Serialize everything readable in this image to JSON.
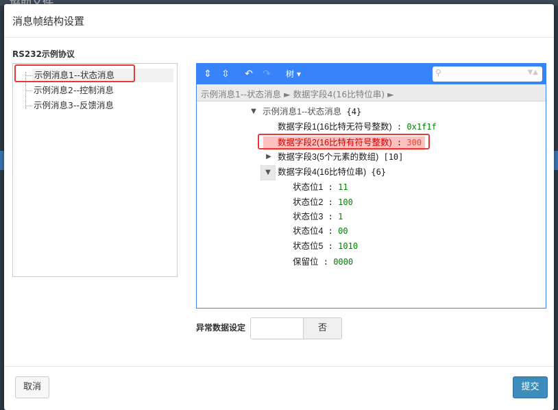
{
  "background": {
    "title": "協助文件"
  },
  "modal": {
    "title": "消息帧结构设置",
    "protocol_title": "RS232示例协议",
    "messages": [
      {
        "label": "示例消息1--状态消息",
        "selected": true
      },
      {
        "label": "示例消息2--控制消息",
        "selected": false
      },
      {
        "label": "示例消息3--反馈消息",
        "selected": false
      }
    ],
    "editor": {
      "menu": {
        "expand_all_icon": "expand-all-icon",
        "collapse_all_icon": "collapse-all-icon",
        "undo_icon": "undo-icon",
        "redo_icon": "redo-icon",
        "mode_label": "树 ▾",
        "search_placeholder": ""
      },
      "navbar": "示例消息1--状态消息 ► 数据字段4(16比特位串) ►",
      "root": {
        "key": "示例消息1--状态消息",
        "count": "{4}"
      },
      "fields": [
        {
          "key": "数据字段1(16比特无符号整数)",
          "sep": " : ",
          "value": "0x1f1f"
        },
        {
          "key": "数据字段2(16比特有符号整数)",
          "sep": " : ",
          "value": "300"
        },
        {
          "key": "数据字段3(5个元素的数组)",
          "count": "[10]"
        },
        {
          "key": "数据字段4(16比特位串)",
          "count": "{6}"
        }
      ],
      "bits": [
        {
          "key": "状态位1",
          "sep": " : ",
          "value": "11"
        },
        {
          "key": "状态位2",
          "sep": " : ",
          "value": "100"
        },
        {
          "key": "状态位3",
          "sep": " : ",
          "value": "1"
        },
        {
          "key": "状态位4",
          "sep": " : ",
          "value": "00"
        },
        {
          "key": "状态位5",
          "sep": " : ",
          "value": "1010"
        },
        {
          "key": "保留位",
          "sep": " : ",
          "value": "0000"
        }
      ]
    },
    "abnormal": {
      "label": "异常数据设定",
      "value": "",
      "button": "否"
    },
    "footer": {
      "cancel": "取消",
      "submit": "提交"
    }
  },
  "colors": {
    "accent": "#3883fa",
    "highlight": "#ffc0c0",
    "submit": "#3c8dbc",
    "annotation": "#e53935"
  }
}
